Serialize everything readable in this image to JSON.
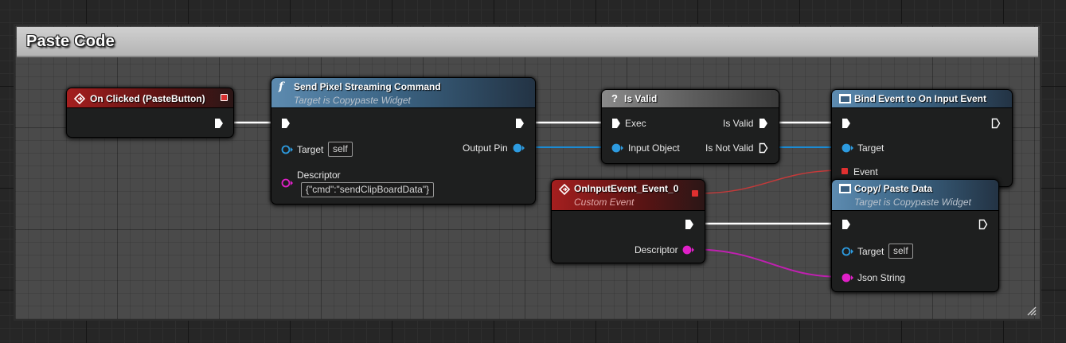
{
  "comment": {
    "title": "Paste Code"
  },
  "nodes": {
    "on_clicked": {
      "title": "On Clicked (PasteButton)"
    },
    "send_pixel": {
      "title": "Send Pixel Streaming Command",
      "subtitle": "Target is Copypaste Widget",
      "pins": {
        "target": "Target",
        "target_value": "self",
        "descriptor": "Descriptor",
        "descriptor_value": "{\"cmd\":\"sendClipBoardData\"}",
        "output": "Output Pin"
      }
    },
    "is_valid": {
      "title": "Is Valid",
      "pins": {
        "exec": "Exec",
        "input_object": "Input Object",
        "is_valid": "Is Valid",
        "is_not_valid": "Is Not Valid"
      }
    },
    "bind_event": {
      "title": "Bind Event to On Input Event",
      "pins": {
        "target": "Target",
        "event": "Event"
      }
    },
    "on_input_event": {
      "title": "OnInputEvent_Event_0",
      "subtitle": "Custom Event",
      "pins": {
        "descriptor": "Descriptor"
      }
    },
    "copy_paste": {
      "title": "Copy/ Paste Data",
      "subtitle": "Target is Copypaste Widget",
      "pins": {
        "target": "Target",
        "target_value": "self",
        "json_string": "Json String"
      }
    }
  },
  "colors": {
    "exec_wire": "#ffffff",
    "object_wire": "#1b8bd4",
    "string_wire": "#e020c8",
    "delegate_wire": "#e03030",
    "event_header": "#a51f1f",
    "function_header": "#5d8bb0",
    "pure_header": "#8a8a8a"
  }
}
